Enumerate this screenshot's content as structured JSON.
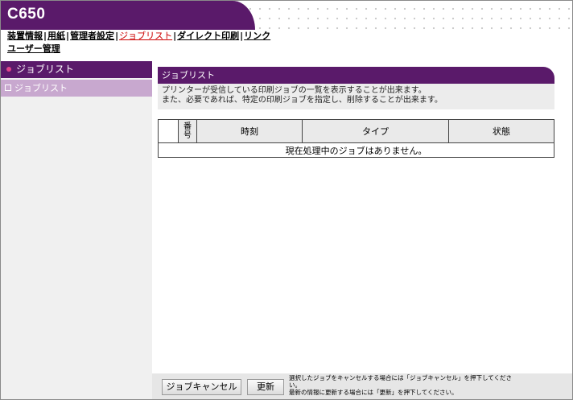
{
  "header": {
    "model": "C650",
    "nav": [
      {
        "label": "装置情報",
        "active": false
      },
      {
        "label": "用紙",
        "active": false
      },
      {
        "label": "管理者設定",
        "active": false
      },
      {
        "label": "ジョブリスト",
        "active": true
      },
      {
        "label": "ダイレクト印刷",
        "active": false
      },
      {
        "label": "リンク",
        "active": false
      }
    ],
    "nav2": "ユーザー管理"
  },
  "sidebar": {
    "heading": "ジョブリスト",
    "items": [
      {
        "label": "ジョブリスト"
      }
    ]
  },
  "main": {
    "section_title": "ジョブリスト",
    "description_line1": "プリンターが受信している印刷ジョブの一覧を表示することが出来ます。",
    "description_line2": "また、必要であれば、特定の印刷ジョブを指定し、削除することが出来ます。",
    "table": {
      "columns": [
        "番号",
        "時刻",
        "タイプ",
        "状態"
      ],
      "empty_message": "現在処理中のジョブはありません。"
    }
  },
  "footer": {
    "cancel_label": "ジョブキャンセル",
    "refresh_label": "更新",
    "hint_line1": "選択したジョブをキャンセルする場合には「ジョブキャンセル」を押下してくださ",
    "hint_line2": "い。",
    "hint_line3": "最新の情報に更新する場合には「更新」を押下してください。"
  },
  "colors": {
    "brand_purple": "#5a1a6a",
    "sidebar_selected": "#c8a8cf",
    "active_link": "#cc0000"
  }
}
